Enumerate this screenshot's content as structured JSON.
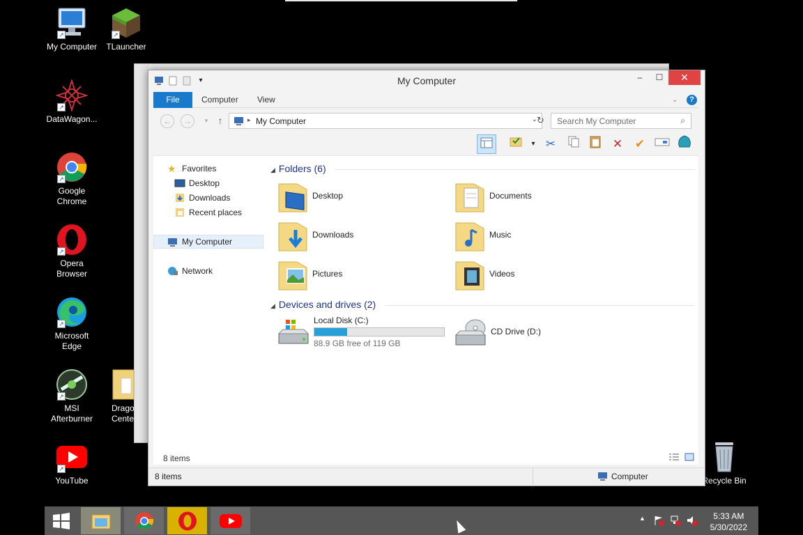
{
  "desktop": {
    "icons": [
      {
        "label": "My Computer",
        "icon": "monitor-icon"
      },
      {
        "label": "TLauncher",
        "icon": "grass-block-icon"
      },
      {
        "label": "DataWagon...",
        "icon": "datawagon-icon"
      },
      {
        "label": "Google Chrome",
        "icon": "chrome-icon"
      },
      {
        "label": "Opera Browser",
        "icon": "opera-icon"
      },
      {
        "label": "Microsoft Edge",
        "icon": "edge-icon"
      },
      {
        "label": "MSI Afterburner",
        "icon": "afterburner-icon"
      },
      {
        "label": "Drago Cente",
        "icon": "folder-icon"
      },
      {
        "label": "YouTube",
        "icon": "youtube-icon"
      },
      {
        "label": "Recycle Bin",
        "icon": "recycle-bin-icon"
      }
    ]
  },
  "window": {
    "title": "My Computer",
    "minimize": "–",
    "maximize": "☐",
    "close": "✕",
    "ribbon_tabs": [
      "File",
      "Computer",
      "View"
    ],
    "address": "My Computer",
    "search_placeholder": "Search My Computer",
    "nav": {
      "favorites": "Favorites",
      "desktop": "Desktop",
      "downloads": "Downloads",
      "recent": "Recent places",
      "my_computer": "My Computer",
      "network": "Network"
    },
    "folders_header": "Folders (6)",
    "folders": [
      {
        "name": "Desktop",
        "icon": "desktop-folder-icon"
      },
      {
        "name": "Documents",
        "icon": "documents-folder-icon"
      },
      {
        "name": "Downloads",
        "icon": "downloads-folder-icon"
      },
      {
        "name": "Music",
        "icon": "music-folder-icon"
      },
      {
        "name": "Pictures",
        "icon": "pictures-folder-icon"
      },
      {
        "name": "Videos",
        "icon": "videos-folder-icon"
      }
    ],
    "devices_header": "Devices and drives (2)",
    "drives": [
      {
        "name": "Local Disk (C:)",
        "free": "88.9 GB free of 119 GB",
        "used_fraction": 0.253
      },
      {
        "name": "CD Drive (D:)"
      }
    ],
    "item_count_inner": "8 items",
    "status_items": "8 items",
    "status_location": "Computer"
  },
  "taskbar": {
    "time": "5:33 AM",
    "date": "5/30/2022"
  },
  "colors": {
    "accent": "#1979ca",
    "close": "#e04343",
    "drive_fill": "#26a0da",
    "header_text": "#1e3287"
  }
}
